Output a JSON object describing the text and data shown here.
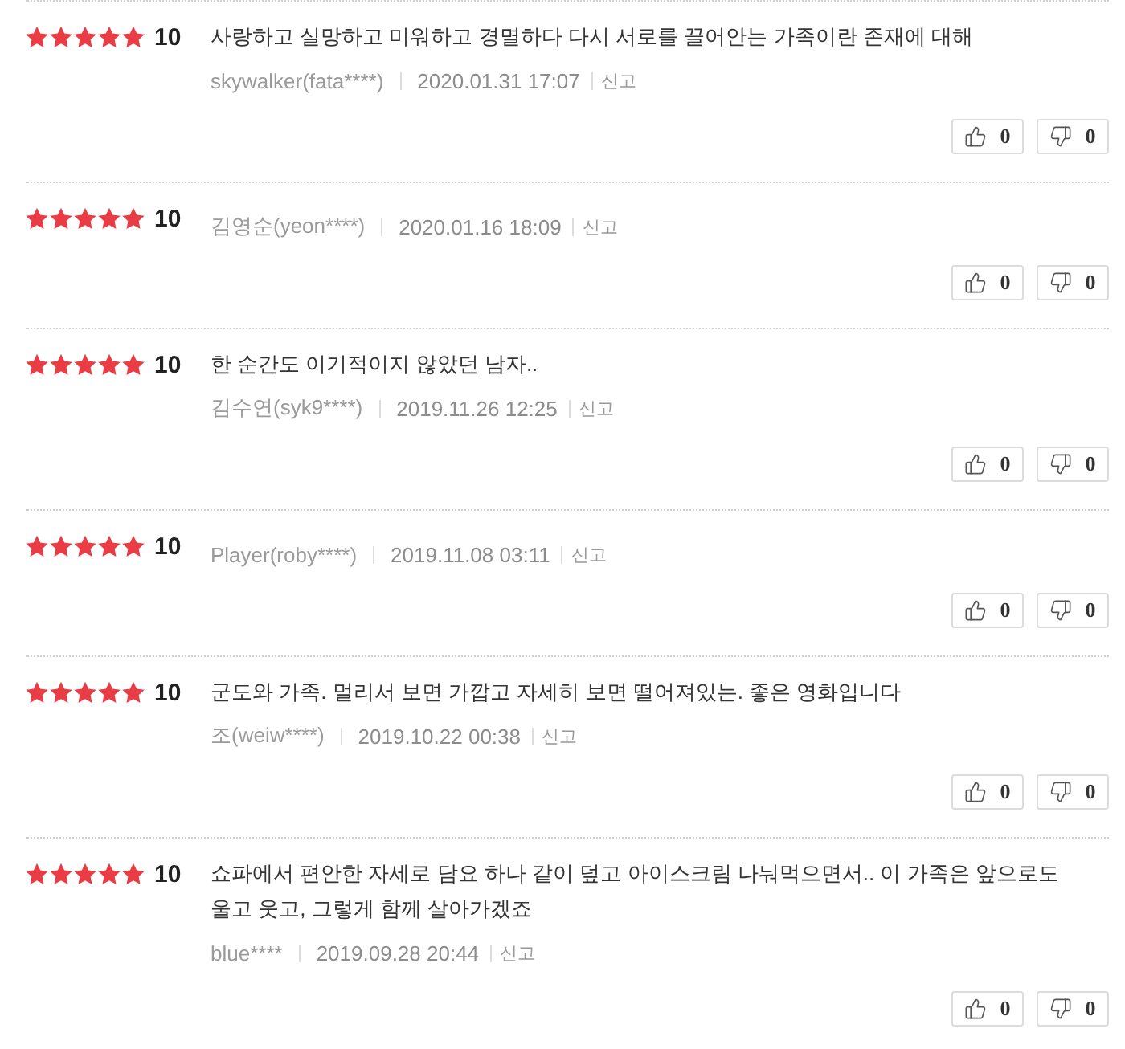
{
  "reviews": [
    {
      "stars": 5,
      "score": "10",
      "comment": "사랑하고 실망하고 미워하고 경멸하다 다시 서로를 끌어안는 가족이란 존재에 대해",
      "author": "skywalker(fata****)",
      "date": "2020.01.31 17:07",
      "report": "신고",
      "likes": "0",
      "dislikes": "0"
    },
    {
      "stars": 5,
      "score": "10",
      "author": "김영순(yeon****)",
      "date": "2020.01.16 18:09",
      "report": "신고",
      "likes": "0",
      "dislikes": "0"
    },
    {
      "stars": 5,
      "score": "10",
      "comment": "한 순간도 이기적이지 않았던 남자..",
      "author": "김수연(syk9****)",
      "date": "2019.11.26 12:25",
      "report": "신고",
      "likes": "0",
      "dislikes": "0"
    },
    {
      "stars": 5,
      "score": "10",
      "author": "Player(roby****)",
      "date": "2019.11.08 03:11",
      "report": "신고",
      "likes": "0",
      "dislikes": "0"
    },
    {
      "stars": 5,
      "score": "10",
      "comment": "군도와 가족. 멀리서 보면 가깝고 자세히 보면 떨어져있는. 좋은 영화입니다",
      "author": "조(weiw****)",
      "date": "2019.10.22 00:38",
      "report": "신고",
      "likes": "0",
      "dislikes": "0"
    },
    {
      "stars": 5,
      "score": "10",
      "comment": "쇼파에서 편안한 자세로 담요 하나 같이 덮고 아이스크림 나눠먹으면서.. 이 가족은 앞으로도 울고 웃고, 그렇게 함께 살아가겠죠",
      "author": "blue****",
      "date": "2019.09.28 20:44",
      "report": "신고",
      "likes": "0",
      "dislikes": "0"
    }
  ]
}
